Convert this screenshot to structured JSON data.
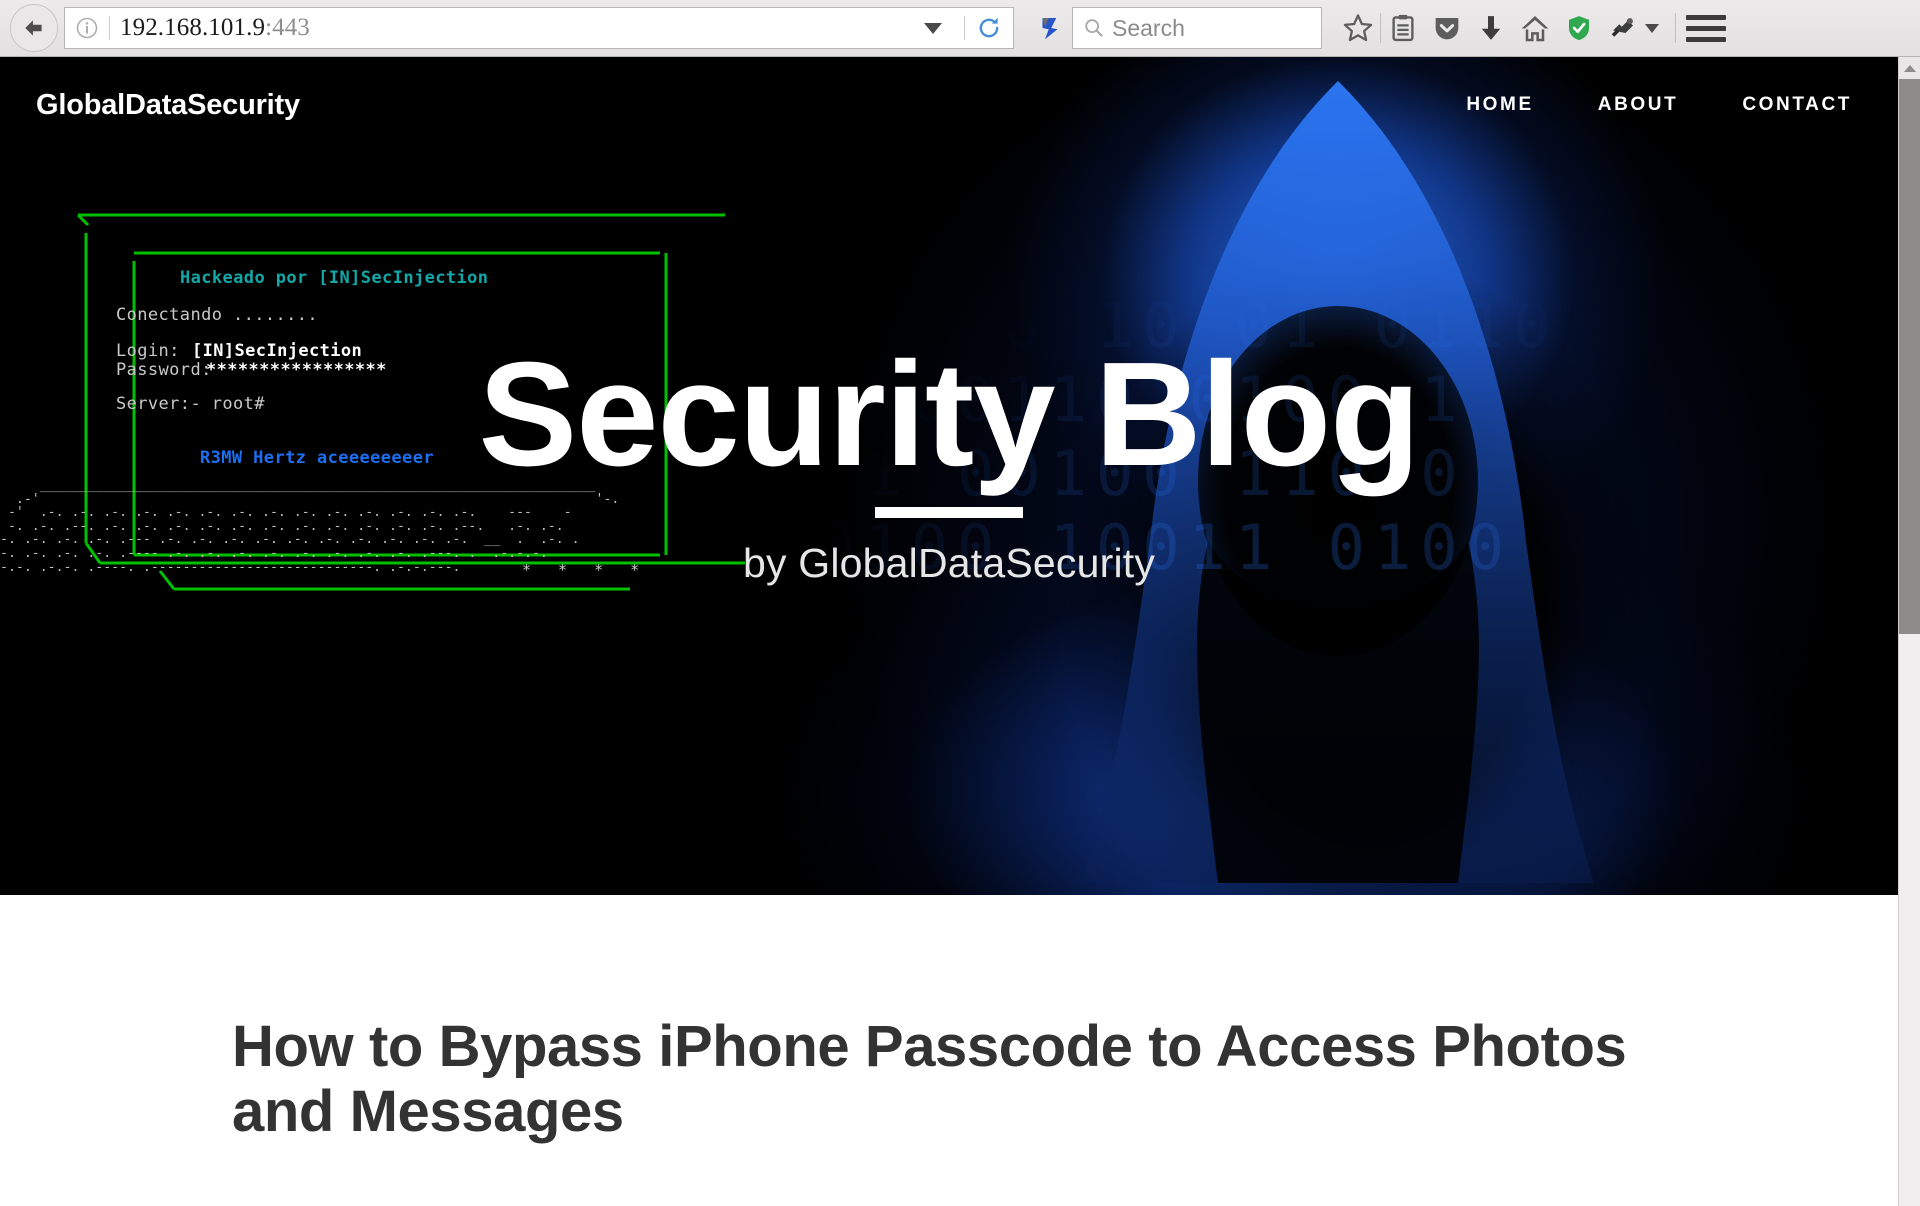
{
  "browser": {
    "back_button": "back-arrow",
    "site_info_icon": "info-circle-icon",
    "url": "192.168.101.9",
    "url_port": ":443",
    "url_dropdown": "chevron-down-icon",
    "reload_icon": "reload-icon",
    "pocket_icon": "pocket-icon",
    "search": {
      "placeholder": "Search",
      "icon": "search-icon"
    },
    "toolbar_icons": [
      {
        "name": "bookmark-star-icon",
        "label": "Bookmark"
      },
      {
        "name": "reader-list-icon",
        "label": "Reading list"
      },
      {
        "name": "pocket-save-icon",
        "label": "Save to Pocket"
      },
      {
        "name": "downloads-icon",
        "label": "Downloads"
      },
      {
        "name": "home-icon",
        "label": "Home"
      },
      {
        "name": "shield-check-icon",
        "label": "Protection"
      },
      {
        "name": "addon-icon",
        "label": "Add-on"
      }
    ],
    "menu_icon": "hamburger-menu-icon"
  },
  "site": {
    "brand": "GlobalDataSecurity",
    "nav": [
      {
        "label": "HOME"
      },
      {
        "label": "ABOUT"
      },
      {
        "label": "CONTACT"
      }
    ]
  },
  "hero": {
    "title": "Security Blog",
    "subtitle": "by GlobalDataSecurity",
    "background_colors": {
      "black": "#000000",
      "blue": "#1c56cd",
      "green": "#00bb00"
    },
    "terminal": {
      "banner": "Hackeado por [IN]SecInjection",
      "connecting": "Conectando ........",
      "login_label": "Login:",
      "login_value": "[IN]SecInjection",
      "password_label": "Password:",
      "password_value": "*****************",
      "server_line": "Server:- root#",
      "signature": "R3MW Hertz aceeeeeeeer",
      "indicator_stars": "*  *  *  *"
    },
    "keyboard_ascii": [
      "     ______________________________________________________________________",
      "  .-'                                                                      '-.",
      " -'  .-. .-. .-. .-. .-. .-. .-. .-. .-. .-. .-. .-. .-. .-.    ---    -   ",
      " -. .-. .--. .-. .-. .-. .-. .-. .-. .-. .-. .-. .-. .-. .--.   .-. .-.  ",
      "-. .-. .-. .-. .--- .-. .-. .-. .-. .-. .-. .-. .-. .-. .-.  __  .  .-. .",
      "-. .-. .-. .-. .---- .-. .-. .-. .-. .-. .-. .-. .-. .---. .  .-.-.-.",
      "-.-. .-.-. .----. .----------------------------. .-.-.---."
    ]
  },
  "article": {
    "title": "How to Bypass iPhone Passcode to Access Photos and Messages"
  },
  "scrollbar": {
    "position": "top",
    "up_arrow": "scroll-up-arrow"
  }
}
